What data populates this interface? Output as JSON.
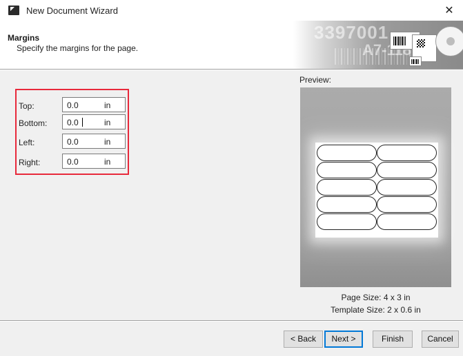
{
  "window": {
    "title": "New Document Wizard",
    "close_glyph": "✕"
  },
  "header": {
    "title": "Margins",
    "subtitle": "Specify the margins for the page.",
    "banner_text_1": "3397001",
    "banner_text_2": "A7-118"
  },
  "margins": {
    "fields": [
      {
        "label": "Top:",
        "value": "0.0",
        "unit": "in"
      },
      {
        "label": "Bottom:",
        "value": "0.0",
        "unit": "in",
        "focused": true
      },
      {
        "label": "Left:",
        "value": "0.0",
        "unit": "in"
      },
      {
        "label": "Right:",
        "value": "0.0",
        "unit": "in"
      }
    ],
    "highlight_color": "#e8283a"
  },
  "preview": {
    "label": "Preview:",
    "page_size": "Page Size:  4 x 3 in",
    "template_size": "Template Size:  2 x 0.6 in",
    "label_rows": 5,
    "label_cols": 2
  },
  "buttons": {
    "back": "< Back",
    "next": "Next >",
    "finish": "Finish",
    "cancel": "Cancel"
  },
  "icons": {
    "app": "document-icon",
    "close": "close-icon"
  }
}
